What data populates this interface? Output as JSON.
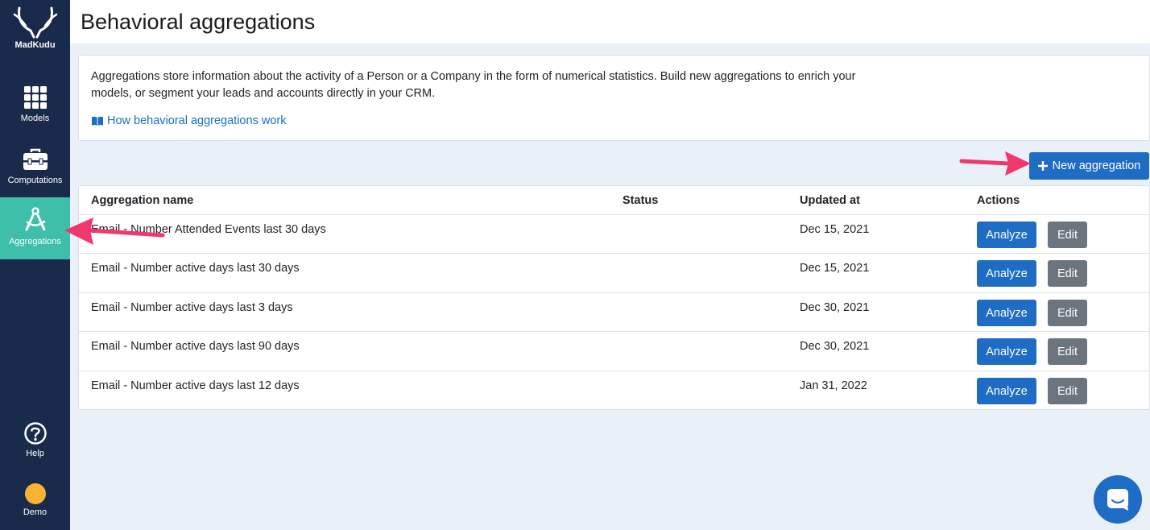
{
  "brand": {
    "name": "MadKudu"
  },
  "sidebar": {
    "items": [
      {
        "label": "Models"
      },
      {
        "label": "Computations"
      },
      {
        "label": "Aggregations"
      }
    ],
    "help_label": "Help",
    "user_label": "Demo",
    "active_color": "#3dbfaa",
    "background_color": "#1a2a4b"
  },
  "header": {
    "title": "Behavioral aggregations"
  },
  "info": {
    "text": "Aggregations store information about the activity of a Person or a Company in the form of numerical statistics. Build new aggregations to enrich your models, or segment your leads and accounts directly in your CRM.",
    "link_label": "How behavioral aggregations work",
    "link_icon": "book-icon"
  },
  "toolbar": {
    "new_label": "New aggregation",
    "new_icon": "plus-icon"
  },
  "table": {
    "columns": [
      "Aggregation name",
      "Status",
      "Updated at",
      "Actions"
    ],
    "rows": [
      {
        "name": "Email - Number Attended Events last 30 days",
        "status": "",
        "updated": "Dec 15, 2021"
      },
      {
        "name": "Email - Number active days last 30 days",
        "status": "",
        "updated": "Dec 15, 2021"
      },
      {
        "name": "Email - Number active days last 3 days",
        "status": "",
        "updated": "Dec 30, 2021"
      },
      {
        "name": "Email - Number active days last 90 days",
        "status": "",
        "updated": "Dec 30, 2021"
      },
      {
        "name": "Email - Number active days last 12 days",
        "status": "",
        "updated": "Jan 31, 2022"
      }
    ],
    "analyze_label": "Analyze",
    "edit_label": "Edit"
  },
  "colors": {
    "primary": "#1f6cc4",
    "secondary": "#6c757d",
    "annotation": "#f0376e"
  }
}
